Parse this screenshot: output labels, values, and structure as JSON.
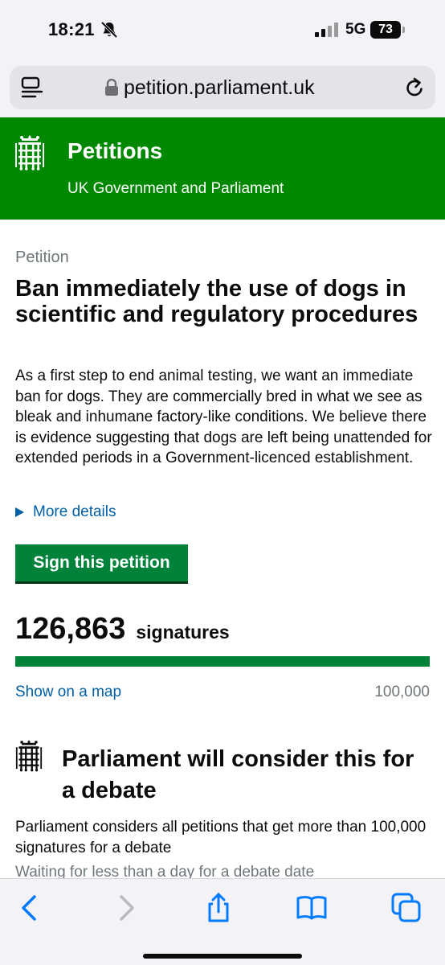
{
  "status_bar": {
    "time": "18:21",
    "network": "5G",
    "battery": "73"
  },
  "address_bar": {
    "url": "petition.parliament.uk"
  },
  "header": {
    "title": "Petitions",
    "subtitle": "UK Government and Parliament",
    "color": "#008800"
  },
  "petition": {
    "caption": "Petition",
    "title": "Ban immediately the use of dogs in scientific and regulatory procedures",
    "body": "As a first step to end animal testing, we want an immediate ban for dogs. They are commercially bred in what we see as bleak and inhumane factory-like conditions. We believe there is evidence suggesting that dogs are left being unattended for extended periods in a Government-licenced establishment.",
    "more_details": "More details",
    "sign_button": "Sign this petition",
    "signature_count": "126,863",
    "signature_label": "signatures",
    "progress_fraction": 1.0,
    "map_link": "Show on a map",
    "threshold": "100,000"
  },
  "debate": {
    "title": "Parliament will consider this for a debate",
    "body": "Parliament considers all petitions that get more than 100,000 signatures for a debate",
    "waiting": "Waiting for less than a day for a debate date"
  },
  "toolbar": {
    "icons": [
      "back-icon",
      "forward-icon",
      "share-icon",
      "bookmarks-icon",
      "tabs-icon"
    ],
    "accent": "#007aff"
  }
}
